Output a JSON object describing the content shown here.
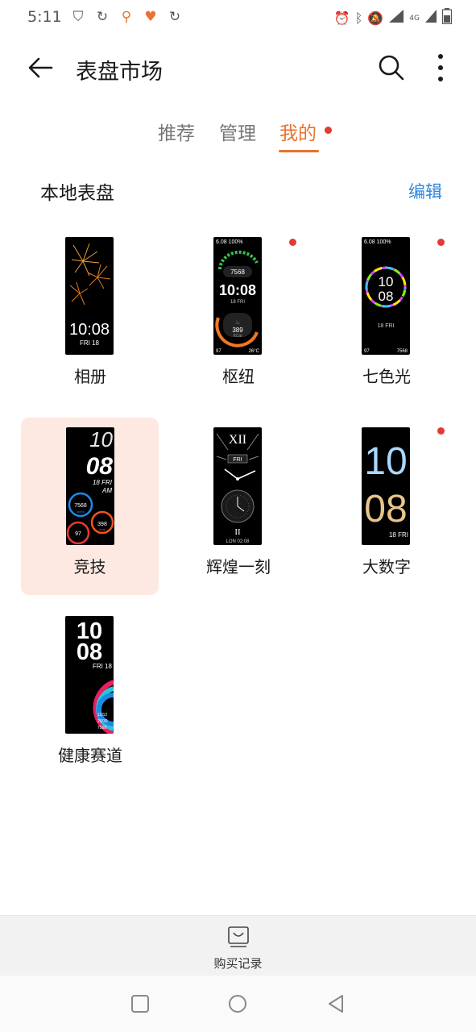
{
  "status": {
    "time": "5:11",
    "left_icons": [
      "shield-icon",
      "refresh-icon",
      "location-icon",
      "heart-icon",
      "refresh-icon"
    ],
    "right_icons": [
      "alarm-icon",
      "bluetooth-icon",
      "mute-icon",
      "signal-icon",
      "network-4g-icon",
      "battery-icon"
    ],
    "network": "4G"
  },
  "appbar": {
    "title": "表盘市场",
    "back_icon": "back-arrow-icon",
    "search_icon": "search-icon",
    "more_icon": "more-vertical-icon"
  },
  "tabs": [
    {
      "label": "推荐",
      "active": false
    },
    {
      "label": "管理",
      "active": false
    },
    {
      "label": "我的",
      "active": true,
      "badge": true
    }
  ],
  "section": {
    "title": "本地表盘",
    "edit_label": "编辑"
  },
  "faces": [
    {
      "label": "相册",
      "new": false,
      "selected": false,
      "preview": {
        "time": "10:08",
        "date": "FRI 18"
      }
    },
    {
      "label": "枢纽",
      "new": true,
      "selected": false,
      "preview": {
        "top": "6.08 100%",
        "steps": "7568",
        "time": "10:08",
        "date": "18 FRI",
        "kcal": "389",
        "kcal_unit": "KCal",
        "bottom_left": "97",
        "bottom_right": "26°C"
      }
    },
    {
      "label": "七色光",
      "new": true,
      "selected": false,
      "preview": {
        "top": "6.08 100%",
        "hour": "10",
        "minute": "08",
        "date": "18 FRI",
        "bottom_left": "97",
        "bottom_right": "7568"
      }
    },
    {
      "label": "竞技",
      "new": false,
      "selected": true,
      "preview": {
        "hour": "10",
        "minute": "08",
        "date": "18 FRI",
        "ampm": "AM",
        "steps": "7568",
        "steps_unit": "steps",
        "kcal": "398",
        "kcal_unit": "kcal",
        "heart": "97"
      }
    },
    {
      "label": "辉煌一刻",
      "new": false,
      "selected": false,
      "preview": {
        "top": "XII",
        "day": "FRI",
        "bottom": "II",
        "city_time": "LON 02:08"
      }
    },
    {
      "label": "大数字",
      "new": true,
      "selected": false,
      "preview": {
        "hour": "10",
        "minute": "08",
        "date": "18 FRI"
      }
    },
    {
      "label": "健康赛道",
      "new": false,
      "selected": false,
      "preview": {
        "hour": "10",
        "minute": "08",
        "date": "FRI 18",
        "stat1": "11/12",
        "stat2": "20/30",
        "stat3": "7568"
      }
    }
  ],
  "bottom": {
    "purchase_label": "购买记录",
    "purchase_icon": "shopping-bag-icon"
  },
  "navbar": {
    "recents_icon": "recents-square-icon",
    "home_icon": "home-circle-icon",
    "back_icon": "back-triangle-icon"
  },
  "colors": {
    "accent": "#e8722f",
    "link": "#2e86de",
    "badge": "#e53935",
    "selected_bg": "#fde9e1"
  }
}
